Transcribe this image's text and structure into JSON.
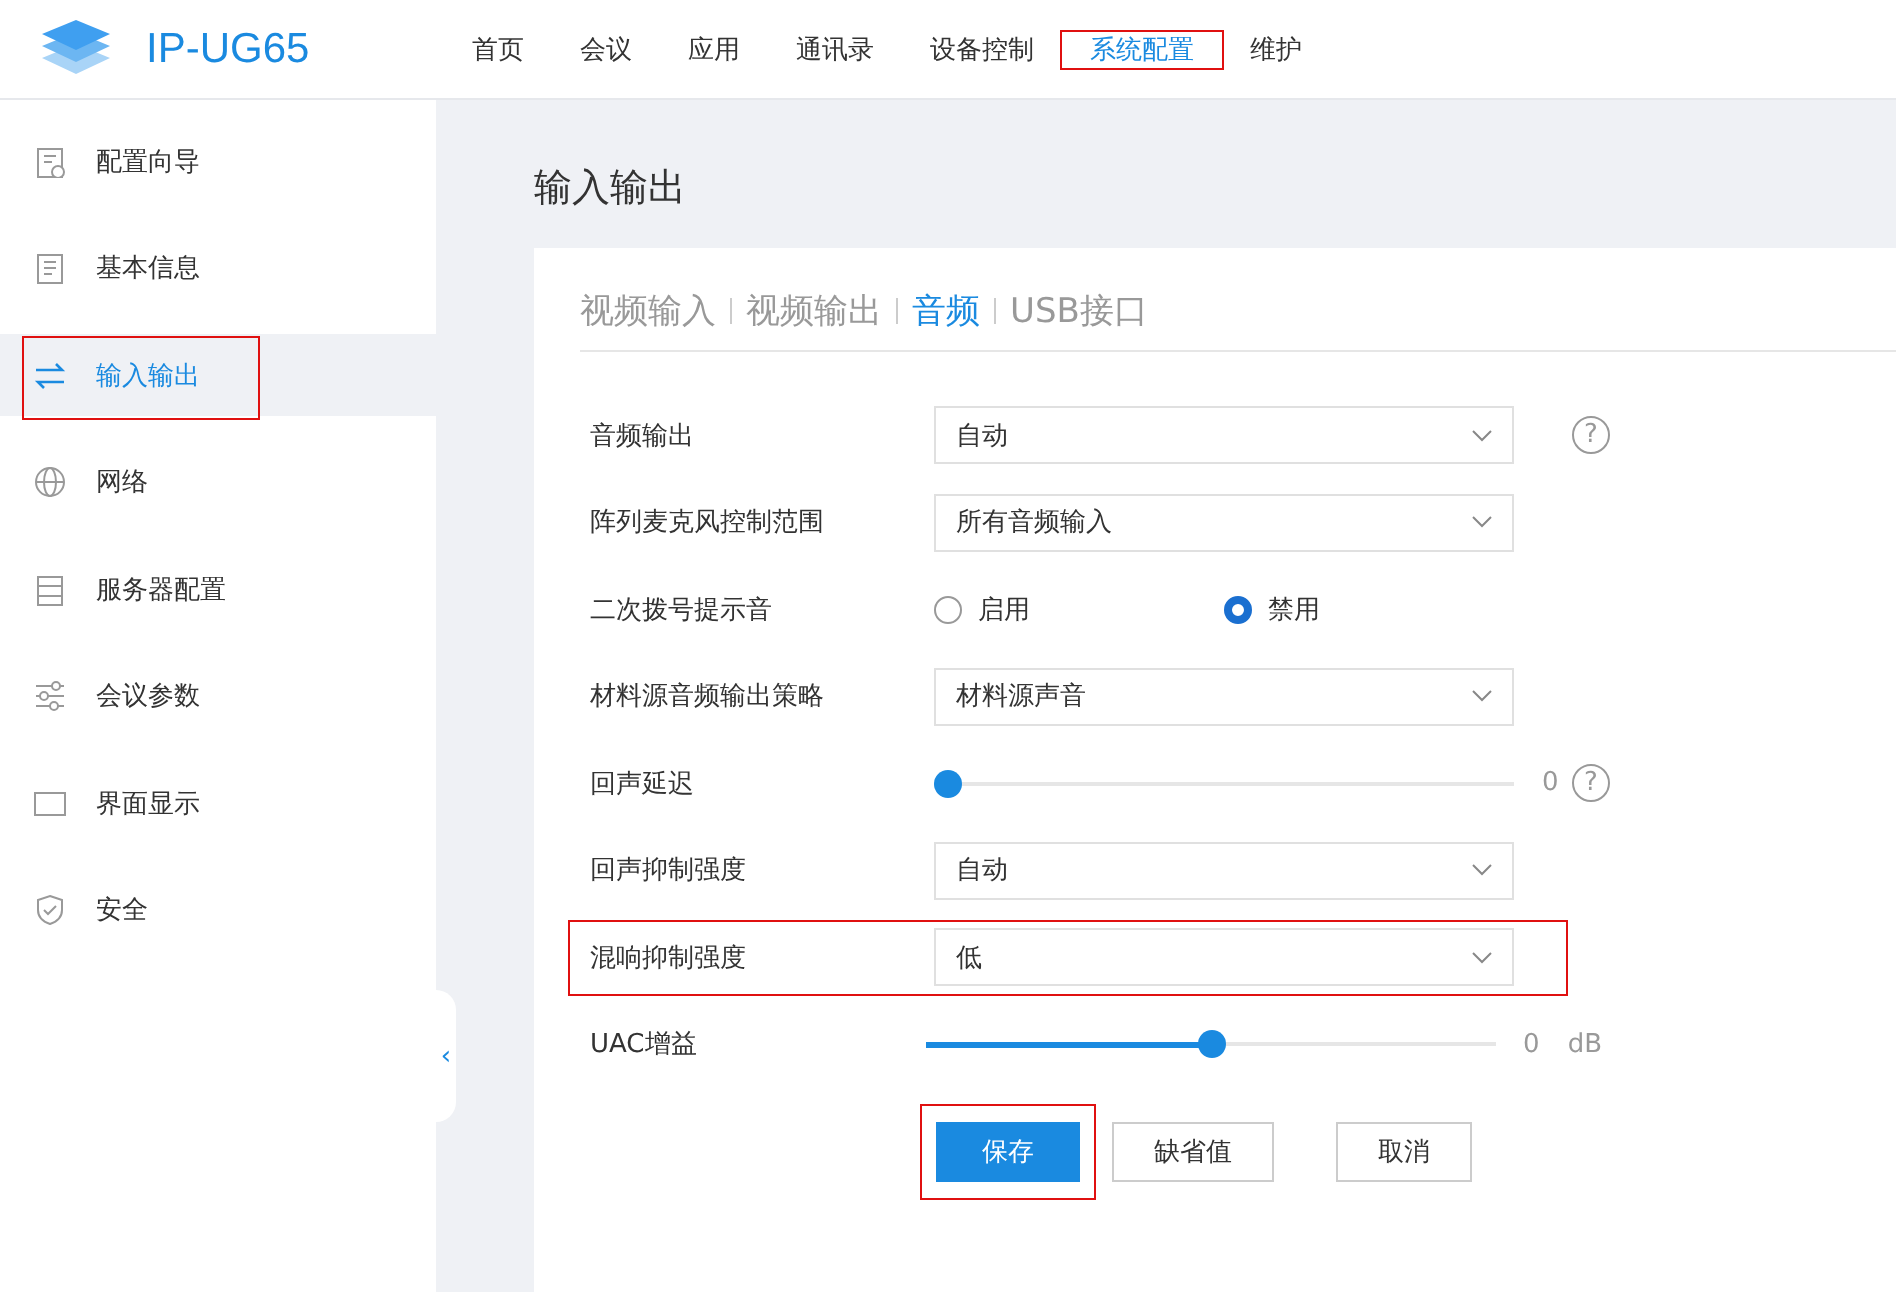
{
  "app": {
    "title": "IP-UG65"
  },
  "nav": [
    {
      "label": "首页",
      "selected": false,
      "highlighted": false
    },
    {
      "label": "会议",
      "selected": false,
      "highlighted": false
    },
    {
      "label": "应用",
      "selected": false,
      "highlighted": false
    },
    {
      "label": "通讯录",
      "selected": false,
      "highlighted": false
    },
    {
      "label": "设备控制",
      "selected": false,
      "highlighted": false
    },
    {
      "label": "系统配置",
      "selected": true,
      "highlighted": true
    },
    {
      "label": "维护",
      "selected": false,
      "highlighted": false
    }
  ],
  "sidebar": {
    "items": [
      {
        "label": "配置向导",
        "selected": false,
        "highlighted": false
      },
      {
        "label": "基本信息",
        "selected": false,
        "highlighted": false
      },
      {
        "label": "输入输出",
        "selected": true,
        "highlighted": true
      },
      {
        "label": "网络",
        "selected": false,
        "highlighted": false
      },
      {
        "label": "服务器配置",
        "selected": false,
        "highlighted": false
      },
      {
        "label": "会议参数",
        "selected": false,
        "highlighted": false
      },
      {
        "label": "界面显示",
        "selected": false,
        "highlighted": false
      },
      {
        "label": "安全",
        "selected": false,
        "highlighted": false
      }
    ],
    "collapse": "‹"
  },
  "page": {
    "title": "输入输出",
    "tabs": [
      {
        "label": "视频输入",
        "selected": false
      },
      {
        "label": "视频输出",
        "selected": false
      },
      {
        "label": "音频",
        "selected": true
      },
      {
        "label": "USB接口",
        "selected": false
      }
    ],
    "rows": [
      {
        "kind": "select",
        "label": "音频输出",
        "value": "自动",
        "help": "?",
        "highlighted": false
      },
      {
        "kind": "select",
        "label": "阵列麦克风控制范围",
        "value": "所有音频输入",
        "highlighted": false
      },
      {
        "kind": "radio",
        "label": "二次拨号提示音",
        "options": [
          {
            "label": "启用",
            "selected": false
          },
          {
            "label": "禁用",
            "selected": true
          }
        ],
        "highlighted": false
      },
      {
        "kind": "select",
        "label": "材料源音频输出策略",
        "value": "材料源声音",
        "highlighted": false
      },
      {
        "kind": "slider",
        "label": "回声延迟",
        "level": 0,
        "reading": "0",
        "help": "?",
        "highlighted": false
      },
      {
        "kind": "select",
        "label": "回声抑制强度",
        "value": "自动",
        "highlighted": false
      },
      {
        "kind": "select",
        "label": "混响抑制强度",
        "value": "低",
        "highlighted": true
      },
      {
        "kind": "slider",
        "label": "UAC增益",
        "level": 0.5,
        "reading": "0",
        "unit": "dB",
        "highlighted": false
      }
    ],
    "buttons": [
      {
        "label": "保存",
        "kind": "primary",
        "highlighted": true
      },
      {
        "label": "缺省值",
        "kind": "default",
        "highlighted": false
      },
      {
        "label": "取消",
        "kind": "default",
        "highlighted": false
      }
    ]
  }
}
